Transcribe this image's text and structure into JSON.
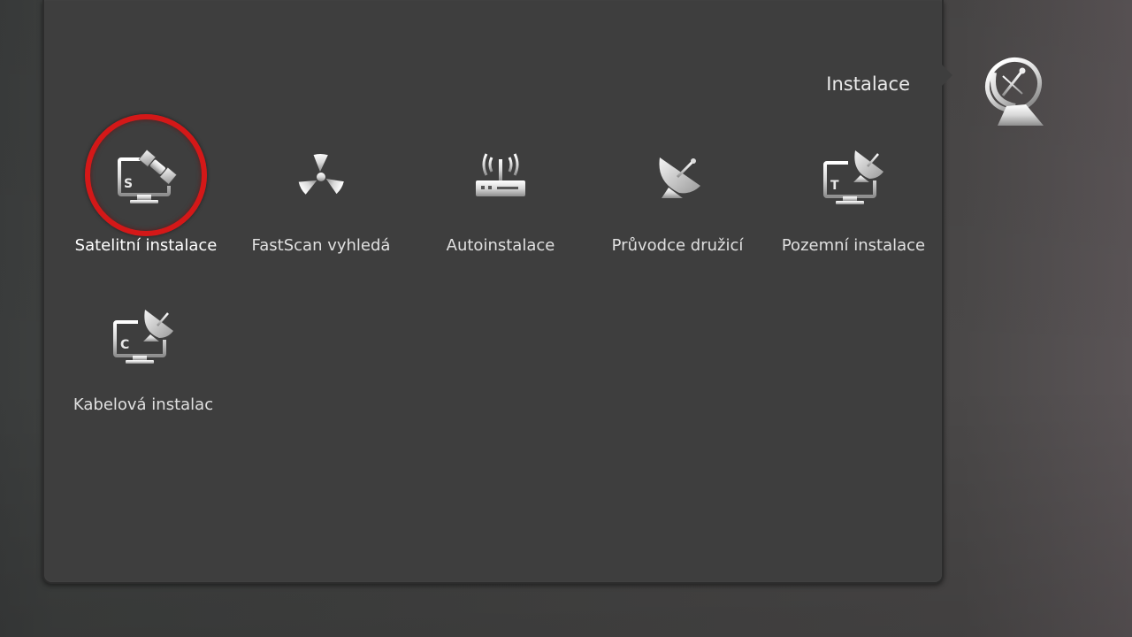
{
  "header": {
    "title": "Instalace",
    "icon": "satellite-dish-icon"
  },
  "menu": {
    "items": [
      {
        "label": "Satelitní instalace",
        "icon": "satellite-monitor-icon",
        "selected": true
      },
      {
        "label": "FastScan vyhledá",
        "icon": "radiation-icon",
        "selected": false
      },
      {
        "label": "Autoinstalace",
        "icon": "router-antenna-icon",
        "selected": false
      },
      {
        "label": "Průvodce družicí",
        "icon": "satellite-dish-icon",
        "selected": false
      },
      {
        "label": "Pozemní instalace",
        "icon": "terrestrial-dish-monitor-icon",
        "selected": false
      },
      {
        "label": "Kabelová instalac",
        "icon": "cable-dish-monitor-icon",
        "selected": false
      }
    ]
  },
  "colors": {
    "selection_ring": "#d41818",
    "panel": "#3e3e3e",
    "text": "#e0e0e0"
  }
}
